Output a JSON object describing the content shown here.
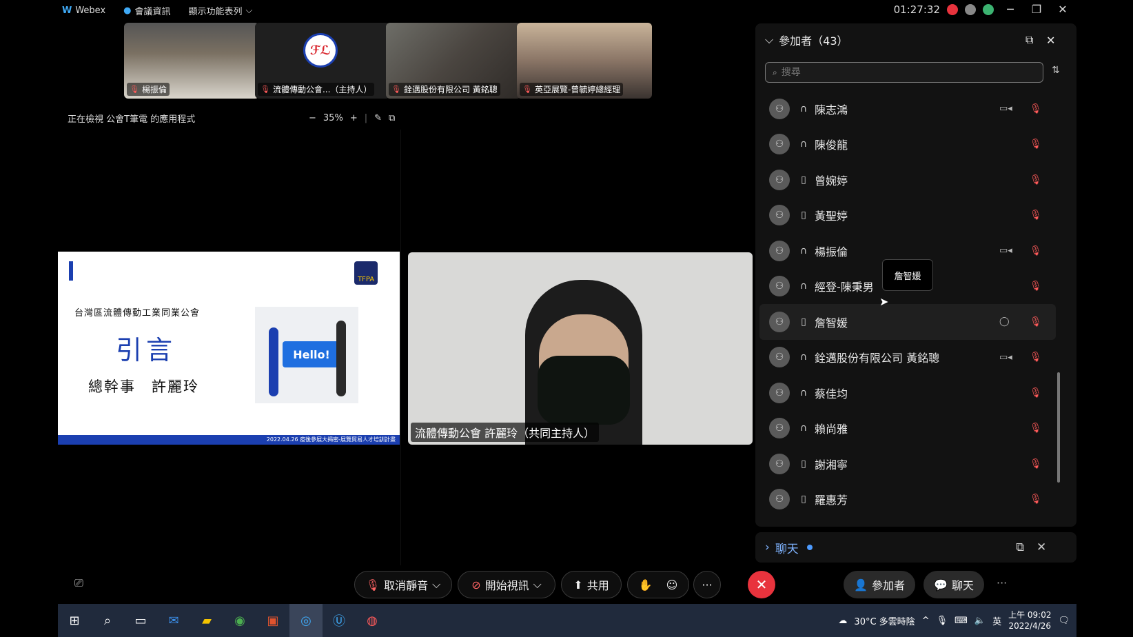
{
  "titlebar": {
    "app_name": "Webex",
    "meeting_info": "會議資訊",
    "show_menu": "顯示功能表列",
    "time": "01:27:32"
  },
  "thumbnails": [
    {
      "name": "楊振倫"
    },
    {
      "name": "流體傳動公會...（主持人）"
    },
    {
      "name": "銓邁股份有限公司 黃銘聰"
    },
    {
      "name": "英亞展覽-曾毓婷總經理"
    }
  ],
  "share_bar": {
    "viewing_text": "正在檢視 公會T筆電 的應用程式",
    "zoom": "35%"
  },
  "slide": {
    "org": "台灣區流體傳動工業同業公會",
    "title": "引言",
    "speaker": "總幹事　許麗玲",
    "hello": "Hello!",
    "footer": "2022.04.26 疫後參展大揭密-展覽貿易人才培訓計畫",
    "logo_text": "TFPA"
  },
  "main_video": {
    "label": "流體傳動公會 許麗玲（共同主持人）"
  },
  "participants": {
    "title": "參加者（43）",
    "search_placeholder": "搜尋",
    "tooltip": "詹智媛",
    "list": [
      {
        "name": "陳志鴻",
        "device": "headset",
        "camera": true
      },
      {
        "name": "陳俊龍",
        "device": "headset",
        "camera": false
      },
      {
        "name": "曾婉婷",
        "device": "phone",
        "camera": false
      },
      {
        "name": "黃聖婷",
        "device": "phone",
        "camera": false
      },
      {
        "name": "楊振倫",
        "device": "headset",
        "camera": true
      },
      {
        "name": "經登-陳秉男",
        "device": "headset",
        "camera": false
      },
      {
        "name": "詹智媛",
        "device": "phone",
        "camera": false
      },
      {
        "name": "銓邁股份有限公司 黃銘聰",
        "device": "headset",
        "camera": true
      },
      {
        "name": "蔡佳均",
        "device": "headset",
        "camera": false
      },
      {
        "name": "賴尚雅",
        "device": "headset",
        "camera": false
      },
      {
        "name": "謝湘寧",
        "device": "phone",
        "camera": false
      },
      {
        "name": "羅惠芳",
        "device": "phone",
        "camera": false
      }
    ]
  },
  "chat_panel": {
    "title": "聊天"
  },
  "controls": {
    "unmute": "取消靜音",
    "start_video": "開始視訊",
    "share": "共用",
    "participants": "參加者",
    "chat": "聊天"
  },
  "taskbar": {
    "weather": "30°C 多雲時陰",
    "ime": "英",
    "time": "上午 09:02",
    "date": "2022/4/26"
  }
}
